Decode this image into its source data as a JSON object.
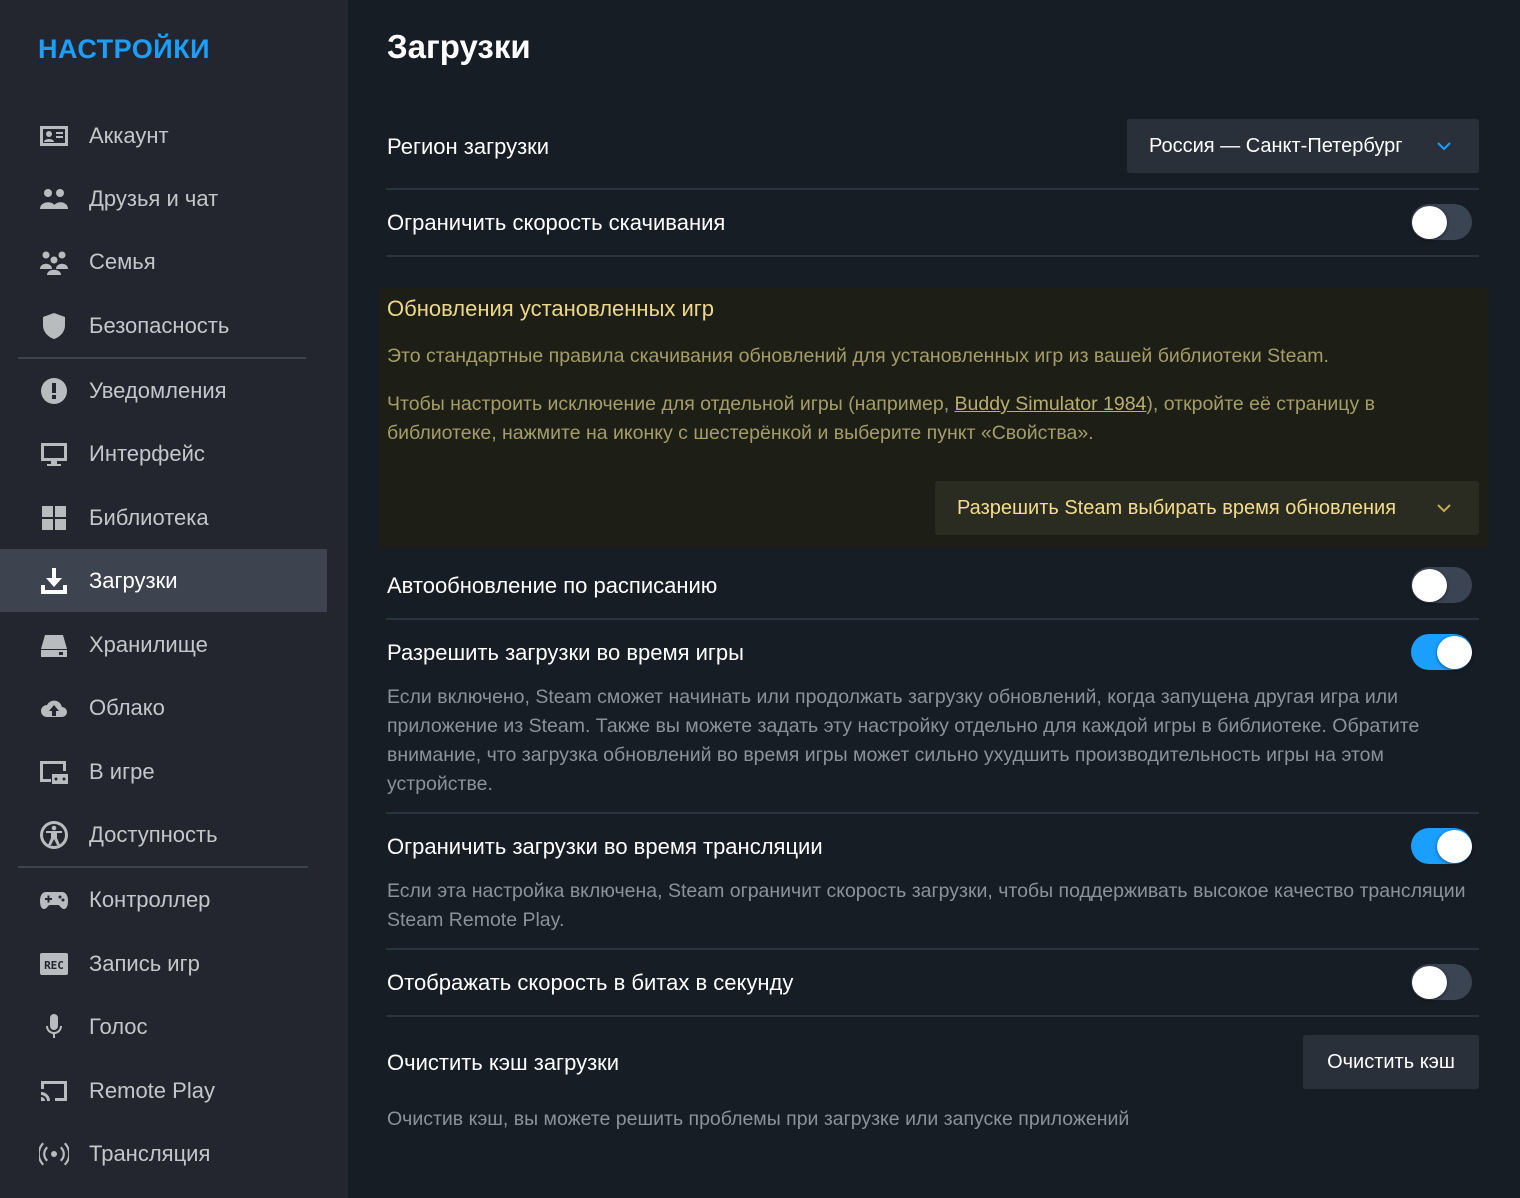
{
  "sidebar": {
    "title": "НАСТРОЙКИ",
    "items": [
      {
        "label": "Аккаунт",
        "icon": "account-card-icon"
      },
      {
        "label": "Друзья и чат",
        "icon": "friends-icon"
      },
      {
        "label": "Семья",
        "icon": "family-icon"
      },
      {
        "label": "Безопасность",
        "icon": "shield-icon"
      },
      {
        "label": "Уведомления",
        "icon": "notification-icon"
      },
      {
        "label": "Интерфейс",
        "icon": "monitor-icon"
      },
      {
        "label": "Библиотека",
        "icon": "grid-icon"
      },
      {
        "label": "Загрузки",
        "icon": "download-icon",
        "active": true
      },
      {
        "label": "Хранилище",
        "icon": "drive-icon"
      },
      {
        "label": "Облако",
        "icon": "cloud-icon"
      },
      {
        "label": "В игре",
        "icon": "ingame-icon"
      },
      {
        "label": "Доступность",
        "icon": "accessibility-icon"
      },
      {
        "label": "Контроллер",
        "icon": "controller-icon"
      },
      {
        "label": "Запись игр",
        "icon": "rec-icon"
      },
      {
        "label": "Голос",
        "icon": "microphone-icon"
      },
      {
        "label": "Remote Play",
        "icon": "cast-icon"
      },
      {
        "label": "Трансляция",
        "icon": "broadcast-icon"
      }
    ]
  },
  "main": {
    "title": "Загрузки",
    "region": {
      "label": "Регион загрузки",
      "value": "Россия — Санкт-Петербург"
    },
    "limit_speed": {
      "label": "Ограничить скорость скачивания",
      "enabled": false
    },
    "updates_panel": {
      "title": "Обновления установленных игр",
      "text1": "Это стандартные правила скачивания обновлений для установленных игр из вашей библиотеки Steam.",
      "text2_before": "Чтобы настроить исключение для отдельной игры (например, ",
      "text2_link": "Buddy Simulator 1984",
      "text2_after": "), откройте её страницу в библиотеке, нажмите на иконку с шестерёнкой и выберите пункт «Свойства».",
      "dropdown_value": "Разрешить Steam выбирать время обновления"
    },
    "auto_update": {
      "label": "Автообновление по расписанию",
      "enabled": false
    },
    "allow_during_game": {
      "label": "Разрешить загрузки во время игры",
      "enabled": true,
      "description": "Если включено, Steam сможет начинать или продолжать загрузку обновлений, когда запущена другая игра или приложение из Steam. Также вы можете задать эту настройку отдельно для каждой игры в библиотеке. Обратите внимание, что загрузка обновлений во время игры может сильно ухудшить производительность игры на этом устройстве."
    },
    "throttle_streaming": {
      "label": "Ограничить загрузки во время трансляции",
      "enabled": true,
      "description": "Если эта настройка включена, Steam ограничит скорость загрузки, чтобы поддерживать высокое качество трансляции Steam Remote Play."
    },
    "bits_per_second": {
      "label": "Отображать скорость в битах в секунду",
      "enabled": false
    },
    "clear_cache": {
      "label": "Очистить кэш загрузки",
      "button": "Очистить кэш",
      "description": "Очистив кэш, вы можете решить проблемы при загрузке или запуске приложений"
    }
  },
  "colors": {
    "accent": "#1a9fff",
    "background": "#171d25",
    "sidebar": "#23262e",
    "panel_title": "#ecd78a"
  }
}
